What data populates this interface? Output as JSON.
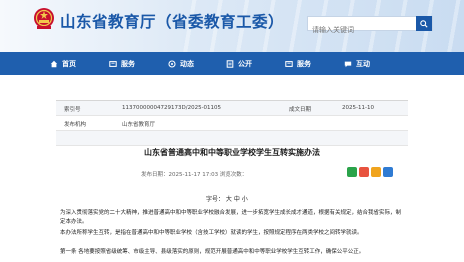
{
  "header": {
    "site_title": "山东省教育厅（省委教育工委）",
    "search_placeholder": "请输入关键词"
  },
  "nav": {
    "items": [
      {
        "label": "首页",
        "icon": "home-icon"
      },
      {
        "label": "服务",
        "icon": "service-icon"
      },
      {
        "label": "动态",
        "icon": "news-icon"
      },
      {
        "label": "公开",
        "icon": "public-icon"
      },
      {
        "label": "服务",
        "icon": "service-icon"
      },
      {
        "label": "互动",
        "icon": "chat-icon"
      }
    ]
  },
  "meta": {
    "rows": [
      {
        "k": "索引号",
        "v": "11370000004729173D/2025-01105",
        "k2": "成文日期",
        "v2": "2025-11-10"
      },
      {
        "k": "发布机构",
        "v": "山东省教育厅",
        "k2": "",
        "v2": ""
      },
      {
        "k": "",
        "v": "",
        "k2": "",
        "v2": ""
      }
    ]
  },
  "article": {
    "title": "山东省普通高中和中等职业学校学生互转实施办法",
    "info": "发布日期：2025-11-17 17:03   浏览次数：",
    "font_size_label": "字号：  大  中  小",
    "paragraphs": [
      "为深入贯彻落实党的二十大精神，推进普通高中和中等职业学校融合发展，进一步拓宽学生成长成才通道，根据有关规定，结合我省实际，制定本办法。",
      "本办法所称学生互转，是指在普通高中和中等职业学校（含技工学校）就读的学生，按照规定程序在两类学校之间转学就读。",
      "第一条  各地要按照省级统筹、市级主导、县级落实的原则，规范开展普通高中和中等职业学校学生互转工作，确保公平公正。"
    ]
  },
  "colors": {
    "brand": "#1a58a8",
    "nav_bg": "#1f5fae",
    "emblem_red": "#c8102e",
    "emblem_gold": "#f2c84b"
  }
}
